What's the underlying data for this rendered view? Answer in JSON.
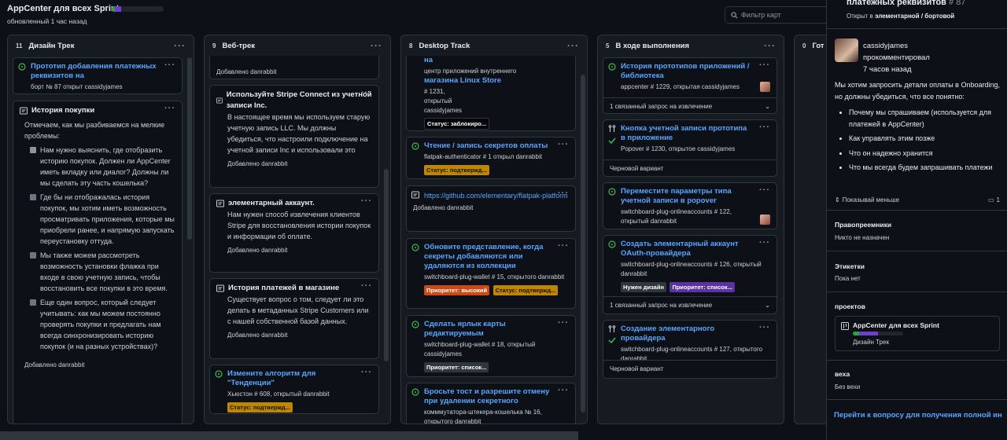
{
  "project": {
    "title": "AppCenter для всех Sprint",
    "updated": "обновленный 1 час назад"
  },
  "filter": {
    "placeholder": "Фильтр карт"
  },
  "columns": [
    {
      "count": "11",
      "name": "Дизайн Трек"
    },
    {
      "count": "9",
      "name": "Веб-трек"
    },
    {
      "count": "8",
      "name": "Desktop Track"
    },
    {
      "count": "5",
      "name": "В ходе выполнения"
    },
    {
      "count": "0",
      "name": "Гот"
    }
  ],
  "col1": {
    "c1": {
      "title": "Прототип добавления платежных реквизитов на",
      "meta": "борт № 87 открыт cassidyjames"
    },
    "c2": {
      "title": "История покупки",
      "intro": "Отмечаем, как мы разбиваемся на мелкие проблемы:",
      "t1": "Нам нужно выяснить, где отобразить историю покупок. Должен ли AppCenter иметь вкладку или диалог? Должны ли мы сделать эту часть кошелька?",
      "t2": "Где бы ни отображалась история покупок, мы хотим иметь возможность просматривать приложения, которые мы приобрели ранее, и напрямую запускать переустановку оттуда.",
      "t3": "Мы также можем рассмотреть возможность установки флажка при входе в свою учетную запись, чтобы восстановить все покупки в это время.",
      "t4": "Еще один вопрос, который следует учитывать: как мы можем постоянно проверять покупки и предлагать нам всегда синхронизировать историю покупок (и на разных устройствах)?",
      "added": "Добавлено danrabbit"
    }
  },
  "col2": {
    "c0": {
      "added": "Добавлено danrabbit"
    },
    "c1": {
      "title": "Используйте Stripe Connect из учетной записи Inc.",
      "text": "В настоящее время мы используем старую учетную запись LLC. Мы должны убедиться, что настроили подключение на учетной записи Inc и использовали это",
      "added": "Добавлено danrabbit"
    },
    "c2": {
      "title": "элементарный аккаунт.",
      "text": "Нам нужен способ извлечения клиентов Stripe для восстановления истории покупок и информации об оплате.",
      "added": "Добавлено danrabbit"
    },
    "c3": {
      "title": "История платежей в магазине",
      "text": "Существует вопрос о том, следует ли это делать в метаданных Stripe Customers или с нашей собственной базой данных.",
      "added": "Добавлено danrabbit"
    },
    "c4": {
      "title": "Измените алгоритм для \"Тенденции\"",
      "meta": "Хьюстон # 608, открытый danrabbit",
      "badge": "Статус: подтвержд..."
    }
  },
  "col3": {
    "c0": {
      "title_tail": "на",
      "meta1": "центр приложений внутреннего",
      "link": "магазина Linux Store",
      "meta2": "# 1231,",
      "meta3": "открытый",
      "meta4": "cassidyjames",
      "badge": "Статус: заблокиро..."
    },
    "c1": {
      "title": "Чтение / запись секретов оплаты",
      "meta": "flatpak-authenticator # 1 открыл danrabbit",
      "badge": "Статус: подтвержд..."
    },
    "c2": {
      "link": "https://github.com/elementary/flatpak-platform",
      "added": "Добавлено danrabbit"
    },
    "c3": {
      "title": "Обновите представление, когда секреты добавляются или удаляются из коллекции",
      "meta": "switchboard-plug-wallet # 15, открытого danrabbit",
      "badge1": "Приоритет: высокий",
      "badge2": "Статус: подтвержд..."
    },
    "c4": {
      "title": "Сделать ярлык карты редактируемым",
      "meta": "switchboard-plug-wallet # 18, открытый cassidyjames",
      "badge": "Приоритет: список..."
    },
    "c5": {
      "title": "Бросьте тост и разрешите отмену при удалении секретного",
      "meta": "комммутатора-штекера-кошелька № 16, открытого danrabbit"
    }
  },
  "col4": {
    "c1": {
      "title": "История прототипов приложений / библиотека",
      "meta": "appcenter # 1229, открытая cassidyjames",
      "linked": "1 связанный запрос на извлечение"
    },
    "c2": {
      "title": "Кнопка учетной записи прототипа в приложение",
      "meta": "Popover # 1230, открытое cassidyjames",
      "draft": "Черновой вариант"
    },
    "c3": {
      "title": "Переместите параметры типа учетной записи в popover",
      "meta": "switchboard-plug-onlineaccounts # 122, открытый danrabbit"
    },
    "c4": {
      "title": "Создать элементарный аккаунт OAuth-провайдера",
      "meta": "switchboard-plug-onlineaccounts # 126, открытый danrabbit",
      "badge1": "Нужен дизайн",
      "badge2": "Приоритет: список...",
      "linked": "1 связанный запрос на извлечение"
    },
    "c5": {
      "title": "Создание элементарного провайдера",
      "meta": "switchboard-plug-onlineaccounts # 127, открытого danrabbit",
      "draft": "Черновой вариант"
    }
  },
  "side": {
    "title": "платежных реквизитов",
    "number": "# 87",
    "opened_prefix": "Открыт в",
    "opened_where": "элементарной / бортовой",
    "author": "cassidyjames",
    "action": "прокомментировал",
    "time": "7 часов назад",
    "body": "Мы хотим запросить детали оплаты в Onboarding, но должны убедиться, что все понятно:",
    "bullets": [
      "Почему мы спрашиваем (используется для платежей в AppCenter)",
      "Как управлять этим позже",
      "Что он надежно хранится",
      "Что мы всегда будем запрашивать платежи"
    ],
    "show_less": "Показывай меньше",
    "comments": "1",
    "assignees_h": "Правопреемники",
    "assignees_v": "Никто не назначен",
    "labels_h": "Этикетки",
    "labels_v": "Пока нет",
    "projects_h": "проектов",
    "project_name": "AppCenter для всех Sprint",
    "project_col": "Дизайн Трек",
    "milestone_h": "веха",
    "milestone_v": "Без вехи",
    "goto": "Перейти к вопросу для получения полной ин"
  }
}
